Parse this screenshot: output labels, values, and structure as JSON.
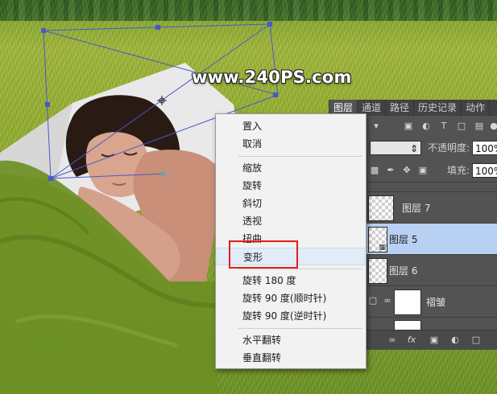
{
  "watermark": "www.240PS.com",
  "layers_panel": {
    "tabs": [
      {
        "label": "图层"
      },
      {
        "label": "通道"
      },
      {
        "label": "路径"
      },
      {
        "label": "历史记录"
      },
      {
        "label": "动作"
      }
    ],
    "opacity_label": "不透明度:",
    "opacity_value": "100%",
    "fill_label": "填充:",
    "fill_value": "100%",
    "layers": [
      {
        "name": "图层 7"
      },
      {
        "name": "图层 5"
      },
      {
        "name": "图层 6"
      },
      {
        "name": "褶皱"
      }
    ],
    "bottom_fx": "fx"
  },
  "context_menu": {
    "items": [
      {
        "label": "置入"
      },
      {
        "label": "取消"
      },
      {
        "label": "缩放"
      },
      {
        "label": "旋转"
      },
      {
        "label": "斜切"
      },
      {
        "label": "透视"
      },
      {
        "label": "扭曲"
      },
      {
        "label": "变形"
      },
      {
        "label": "旋转 180 度"
      },
      {
        "label": "旋转 90 度(顺时针)"
      },
      {
        "label": "旋转 90 度(逆时针)"
      },
      {
        "label": "水平翻转"
      },
      {
        "label": "垂直翻转"
      }
    ],
    "highlighted_item": "变形"
  },
  "colors": {
    "selection_highlight": "#b8d0f2",
    "annotation_box": "#e41d1d",
    "transform_handles": "#4a58c8"
  }
}
